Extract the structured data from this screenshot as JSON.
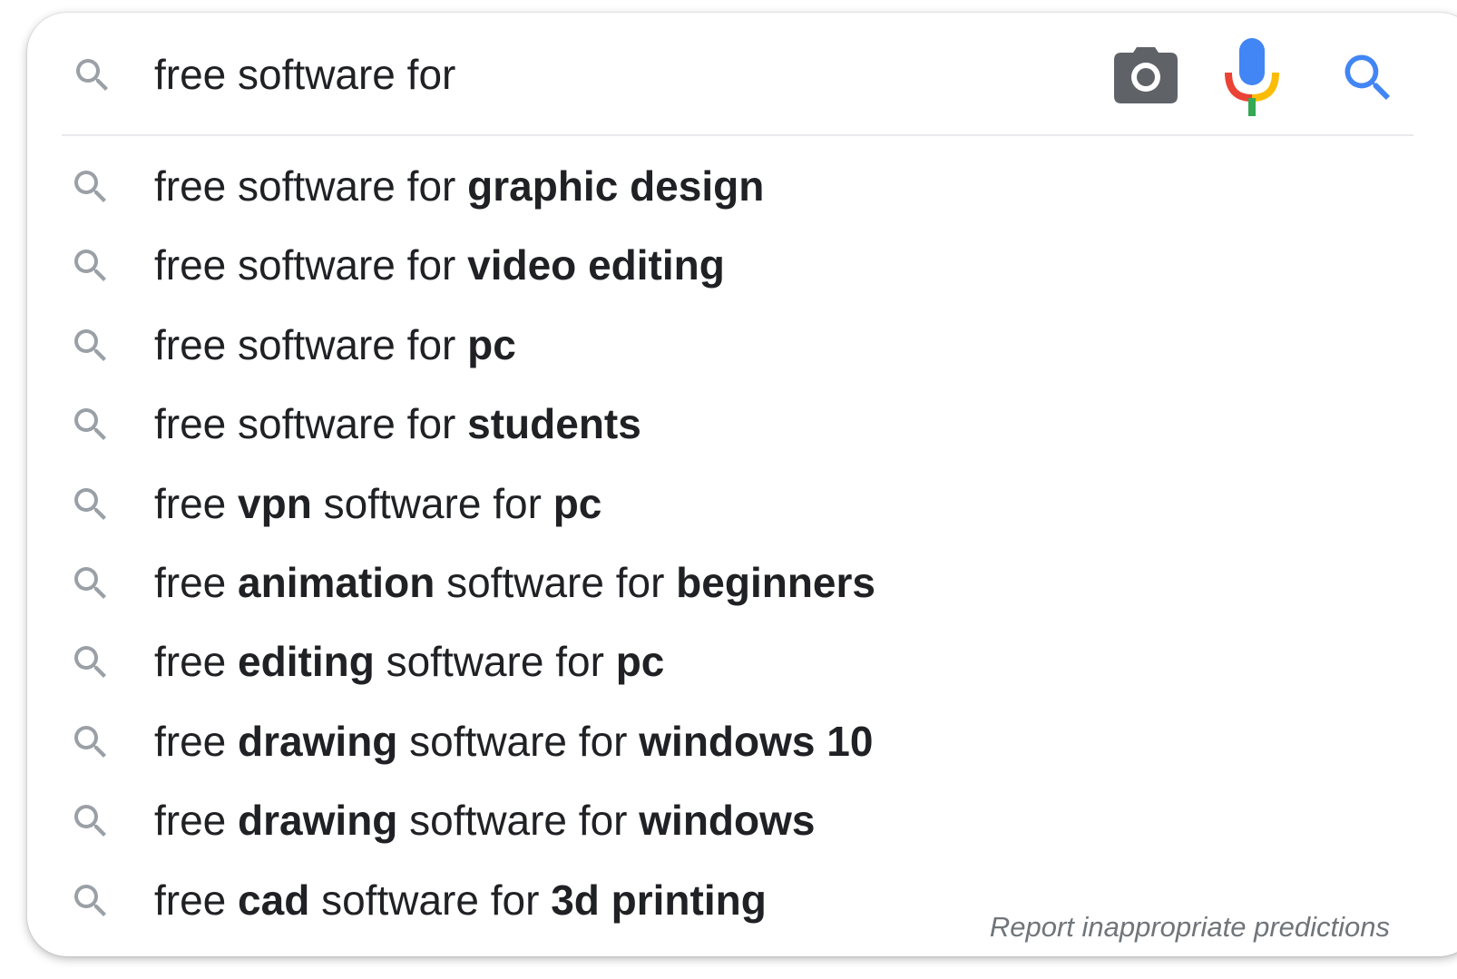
{
  "search": {
    "query": "free software for",
    "icons": {
      "lead": "search-icon",
      "camera": "camera-icon",
      "mic": "microphone-icon",
      "submit": "search-icon"
    }
  },
  "colors": {
    "text": "#202124",
    "muted_icon": "#9aa0a6",
    "camera_icon": "#5f6368",
    "search_blue": "#4285f4",
    "mic_red": "#ea4335",
    "mic_yellow": "#fbbc05",
    "mic_green": "#34a853",
    "report_text": "#70757a"
  },
  "suggestions": [
    {
      "parts": [
        {
          "t": "free software for ",
          "b": false
        },
        {
          "t": "graphic design",
          "b": true
        }
      ]
    },
    {
      "parts": [
        {
          "t": "free software for ",
          "b": false
        },
        {
          "t": "video editing",
          "b": true
        }
      ]
    },
    {
      "parts": [
        {
          "t": "free software for ",
          "b": false
        },
        {
          "t": "pc",
          "b": true
        }
      ]
    },
    {
      "parts": [
        {
          "t": "free software for ",
          "b": false
        },
        {
          "t": "students",
          "b": true
        }
      ]
    },
    {
      "parts": [
        {
          "t": "free ",
          "b": false
        },
        {
          "t": "vpn",
          "b": true
        },
        {
          "t": " software for ",
          "b": false
        },
        {
          "t": "pc",
          "b": true
        }
      ]
    },
    {
      "parts": [
        {
          "t": "free ",
          "b": false
        },
        {
          "t": "animation",
          "b": true
        },
        {
          "t": " software for ",
          "b": false
        },
        {
          "t": "beginners",
          "b": true
        }
      ]
    },
    {
      "parts": [
        {
          "t": "free ",
          "b": false
        },
        {
          "t": "editing",
          "b": true
        },
        {
          "t": " software for ",
          "b": false
        },
        {
          "t": "pc",
          "b": true
        }
      ]
    },
    {
      "parts": [
        {
          "t": "free ",
          "b": false
        },
        {
          "t": "drawing",
          "b": true
        },
        {
          "t": " software for ",
          "b": false
        },
        {
          "t": "windows 10",
          "b": true
        }
      ]
    },
    {
      "parts": [
        {
          "t": "free ",
          "b": false
        },
        {
          "t": "drawing",
          "b": true
        },
        {
          "t": " software for ",
          "b": false
        },
        {
          "t": "windows",
          "b": true
        }
      ]
    },
    {
      "parts": [
        {
          "t": "free ",
          "b": false
        },
        {
          "t": "cad",
          "b": true
        },
        {
          "t": " software for ",
          "b": false
        },
        {
          "t": "3d printing",
          "b": true
        }
      ]
    }
  ],
  "footer": {
    "report_label": "Report inappropriate predictions"
  }
}
